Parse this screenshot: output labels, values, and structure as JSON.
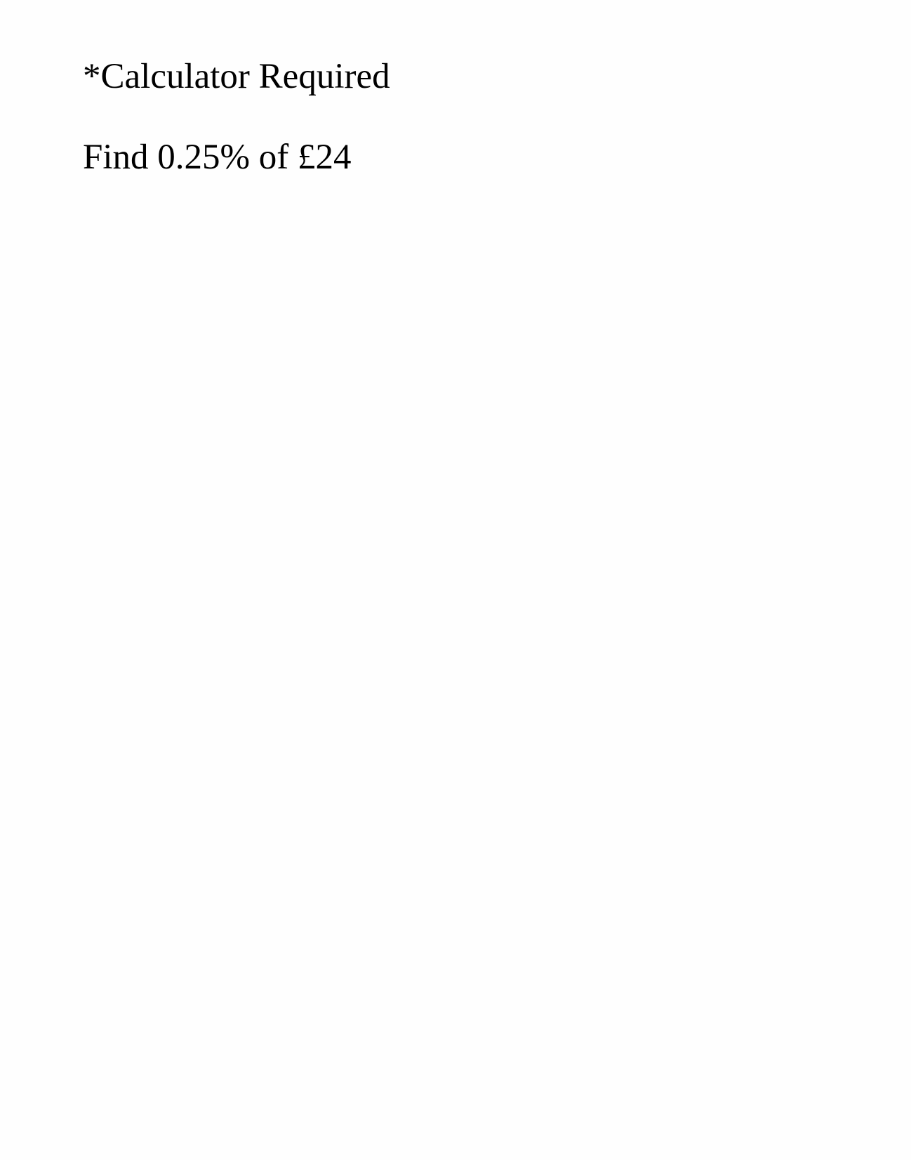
{
  "document": {
    "note": "*Calculator Required",
    "question": "Find 0.25% of £24"
  }
}
